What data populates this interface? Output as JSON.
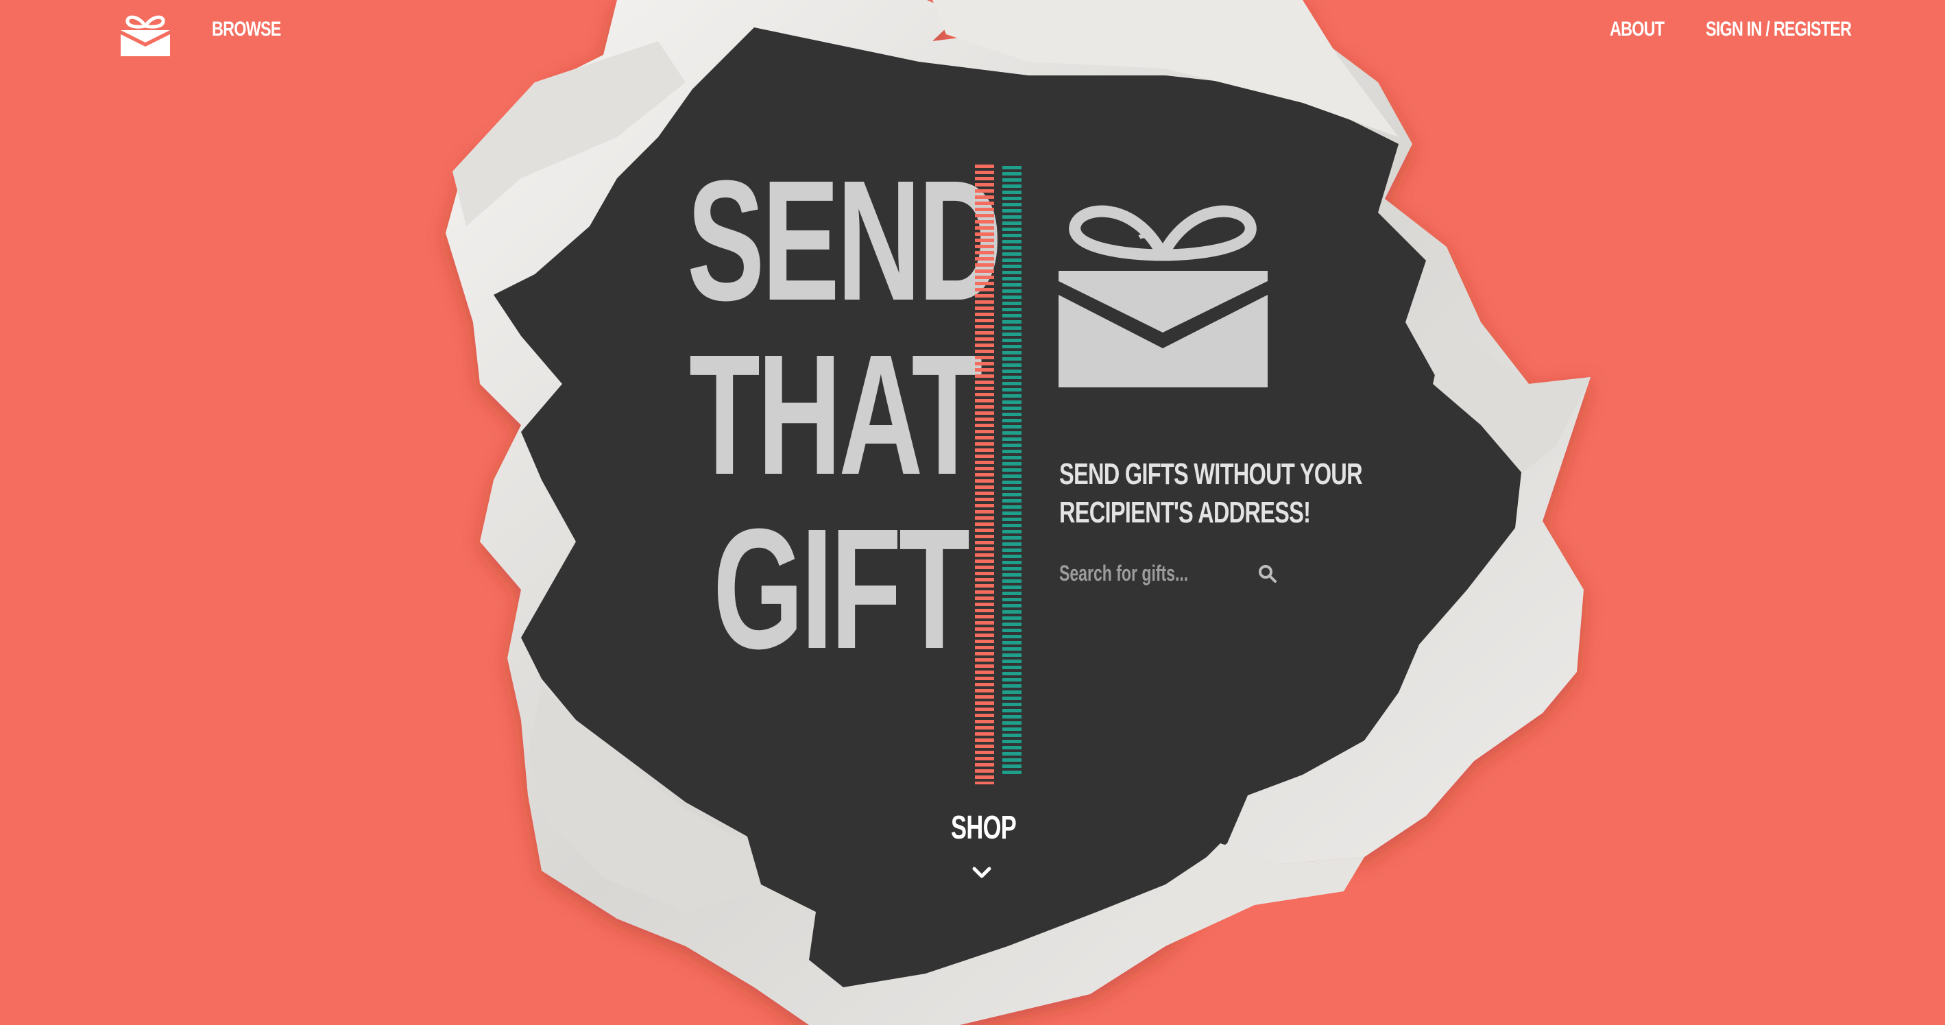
{
  "nav": {
    "browse_label": "BROWSE",
    "about_label": "ABOUT",
    "signin_label": "SIGN IN / REGISTER",
    "logo_icon": "gift-envelope-icon"
  },
  "hero": {
    "title_line1": "SEND",
    "title_line2": "THAT",
    "title_line3": "GIFT",
    "tagline": "SEND GIFTS WITHOUT YOUR RECIPIENT'S ADDRESS!",
    "search_placeholder": "Search for gifts...",
    "search_icon": "search-icon",
    "shop_label": "SHOP",
    "shop_icon": "chevron-down-icon"
  },
  "colors": {
    "background": "#f46d5e",
    "hole": "#333333",
    "paper": "#e9e7e4",
    "title": "#cfcfcf",
    "accent_red": "#f46d5e",
    "accent_teal": "#1fa08c",
    "white": "#ffffff"
  }
}
